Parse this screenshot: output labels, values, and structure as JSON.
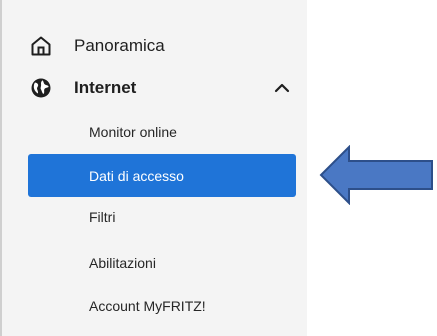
{
  "sidebar": {
    "items": [
      {
        "label": "Panoramica",
        "icon": "home-icon"
      },
      {
        "label": "Internet",
        "icon": "globe-icon",
        "expanded": true
      }
    ],
    "subitems": [
      {
        "label": "Monitor online"
      },
      {
        "label": "Dati di accesso",
        "active": true
      },
      {
        "label": "Filtri"
      },
      {
        "label": "Abilitazioni"
      },
      {
        "label": "Account MyFRITZ!"
      }
    ]
  },
  "annotation": {
    "icon": "left-arrow-icon",
    "color": "#4a78c4"
  },
  "colors": {
    "accent": "#1f74d8",
    "sidebar_bg": "#f4f4f4"
  }
}
